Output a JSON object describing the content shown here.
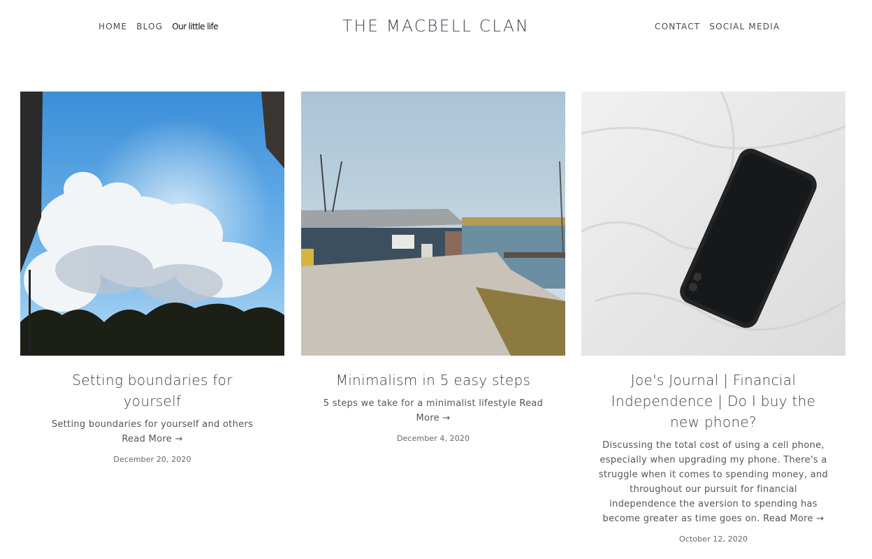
{
  "header": {
    "site_title": "THE MACBELL CLAN",
    "nav_left": [
      {
        "label": "HOME"
      },
      {
        "label": "BLOG"
      },
      {
        "label": "Our little life"
      }
    ],
    "nav_right": [
      {
        "label": "CONTACT"
      },
      {
        "label": "SOCIAL MEDIA"
      }
    ]
  },
  "posts": [
    {
      "title": "Setting boundaries for yourself",
      "excerpt": "Setting boundaries for yourself and others",
      "read_more": "Read More →",
      "date": "December 20, 2020",
      "image": "sky-clouds-photo"
    },
    {
      "title": "Minimalism in 5 easy steps",
      "excerpt": "5 steps we take for a minimalist lifestyle",
      "read_more": "Read More →",
      "date": "December 4, 2020",
      "image": "dock-shed-photo"
    },
    {
      "title": "Joe's Journal | Financial Independence | Do I buy the new phone?",
      "excerpt": "Discussing the total cost of using a cell phone, especially when upgrading my phone. There's a struggle when it comes to spending money, and throughout our pursuit for financial independence the aversion to spending has become greater as time goes on.",
      "read_more": "Read More →",
      "date": "October 12, 2020",
      "image": "phone-on-sheet-photo"
    }
  ]
}
